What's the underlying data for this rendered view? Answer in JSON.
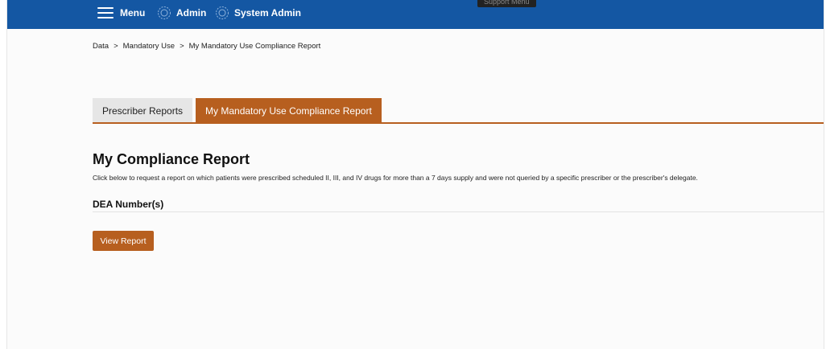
{
  "topnav": {
    "menu_label": "Menu",
    "admin_label": "Admin",
    "system_admin_label": "System Admin",
    "tooltip": "Support Menu"
  },
  "breadcrumb": {
    "items": [
      "Data",
      "Mandatory Use",
      "My Mandatory Use Compliance Report"
    ],
    "separator": ">"
  },
  "tabs": [
    {
      "label": "Prescriber Reports",
      "active": false
    },
    {
      "label": "My Mandatory Use Compliance Report",
      "active": true
    }
  ],
  "report": {
    "title": "My Compliance Report",
    "description": "Click below to request a report on which patients were prescribed scheduled II, III, and IV drugs for more than a 7 days supply and were not queried by a specific prescriber or the prescriber's delegate.",
    "dea_label": "DEA Number(s)",
    "button_label": "View Report"
  },
  "colors": {
    "nav_bg": "#1457a3",
    "accent": "#b75f1f"
  },
  "icons": [
    "hamburger-menu-icon",
    "gear-icon"
  ]
}
